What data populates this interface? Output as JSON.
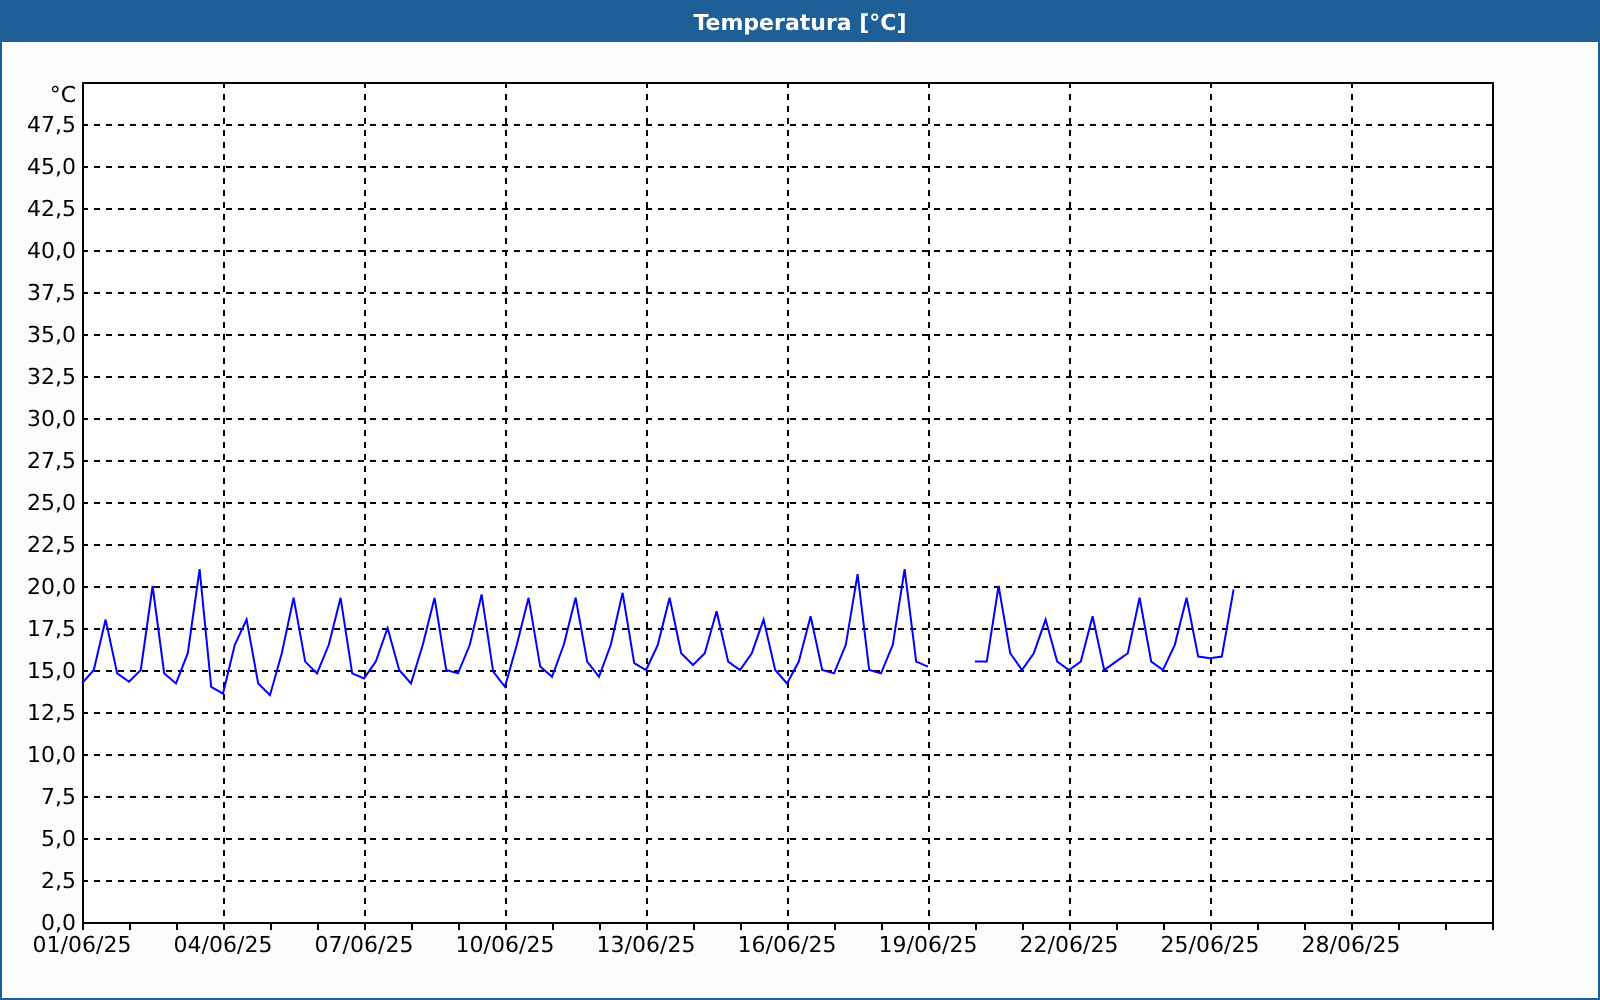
{
  "window": {
    "title": "Temperatura [°C]"
  },
  "chart_data": {
    "type": "line",
    "grid": true,
    "ylabel": "°C",
    "ylim": [
      0,
      50
    ],
    "yticks": [
      {
        "value": 0,
        "label": "0,0"
      },
      {
        "value": 2.5,
        "label": "2,5"
      },
      {
        "value": 5,
        "label": "5,0"
      },
      {
        "value": 7.5,
        "label": "7,5"
      },
      {
        "value": 10,
        "label": "10,0"
      },
      {
        "value": 12.5,
        "label": "12,5"
      },
      {
        "value": 15,
        "label": "15,0"
      },
      {
        "value": 17.5,
        "label": "17,5"
      },
      {
        "value": 20,
        "label": "20,0"
      },
      {
        "value": 22.5,
        "label": "22,5"
      },
      {
        "value": 25,
        "label": "25,0"
      },
      {
        "value": 27.5,
        "label": "27,5"
      },
      {
        "value": 30,
        "label": "30,0"
      },
      {
        "value": 32.5,
        "label": "32,5"
      },
      {
        "value": 35,
        "label": "35,0"
      },
      {
        "value": 37.5,
        "label": "37,5"
      },
      {
        "value": 40,
        "label": "40,0"
      },
      {
        "value": 42.5,
        "label": "42,5"
      },
      {
        "value": 45,
        "label": "45,0"
      },
      {
        "value": 47.5,
        "label": "47,5"
      }
    ],
    "categories": [
      "01/06/25",
      null,
      null,
      null,
      null,
      null,
      null,
      null,
      null,
      null,
      null,
      null,
      "04/06/25",
      null,
      null,
      null,
      null,
      null,
      null,
      null,
      null,
      null,
      null,
      null,
      "07/06/25",
      null,
      null,
      null,
      null,
      null,
      null,
      null,
      null,
      null,
      null,
      null,
      "10/06/25",
      null,
      null,
      null,
      null,
      null,
      null,
      null,
      null,
      null,
      null,
      null,
      "13/06/25",
      null,
      null,
      null,
      null,
      null,
      null,
      null,
      null,
      null,
      null,
      null,
      "16/06/25",
      null,
      null,
      null,
      null,
      null,
      null,
      null,
      null,
      null,
      null,
      null,
      "19/06/25",
      null,
      null,
      null,
      null,
      null,
      null,
      null,
      null,
      null,
      null,
      null,
      "22/06/25",
      null,
      null,
      null,
      null,
      null,
      null,
      null,
      null,
      null,
      null,
      null,
      "25/06/25",
      null,
      null,
      null,
      null,
      null,
      null,
      null,
      null,
      null,
      null,
      null,
      "28/06/25",
      null,
      null,
      null,
      null,
      null,
      null,
      null,
      null,
      null,
      null,
      null
    ],
    "series": [
      {
        "color": "#0000ff",
        "values": [
          14.2,
          15.0,
          18.0,
          14.8,
          14.3,
          15.0,
          20.0,
          14.8,
          14.2,
          16.0,
          21.0,
          14.0,
          13.6,
          16.5,
          18.0,
          14.2,
          13.5,
          16.0,
          19.3,
          15.5,
          14.8,
          16.5,
          19.3,
          14.8,
          14.5,
          15.5,
          17.5,
          15.0,
          14.2,
          16.5,
          19.3,
          15.0,
          14.8,
          16.5,
          19.5,
          14.9,
          14.0,
          16.5,
          19.3,
          15.2,
          14.6,
          16.5,
          19.3,
          15.5,
          14.6,
          16.5,
          19.6,
          15.4,
          15.0,
          16.5,
          19.3,
          16.0,
          15.3,
          16.0,
          18.5,
          15.5,
          15.0,
          16.0,
          18.0,
          15.0,
          14.2,
          15.5,
          18.2,
          15.0,
          14.8,
          16.5,
          20.7,
          15.0,
          14.8,
          16.5,
          21.0,
          15.5,
          15.2,
          null,
          null,
          null,
          15.5,
          15.5,
          20.0,
          16.0,
          15.0,
          16.0,
          18.0,
          15.5,
          15.0,
          15.5,
          18.2,
          15.0,
          15.5,
          16.0,
          19.3,
          15.5,
          15.0,
          16.5,
          19.3,
          15.8,
          15.7,
          15.8,
          19.8,
          null,
          null,
          null,
          null,
          null,
          null,
          null,
          null,
          null,
          null,
          null,
          null,
          null,
          null,
          null,
          null,
          null,
          null,
          null,
          null,
          null
        ]
      }
    ]
  }
}
